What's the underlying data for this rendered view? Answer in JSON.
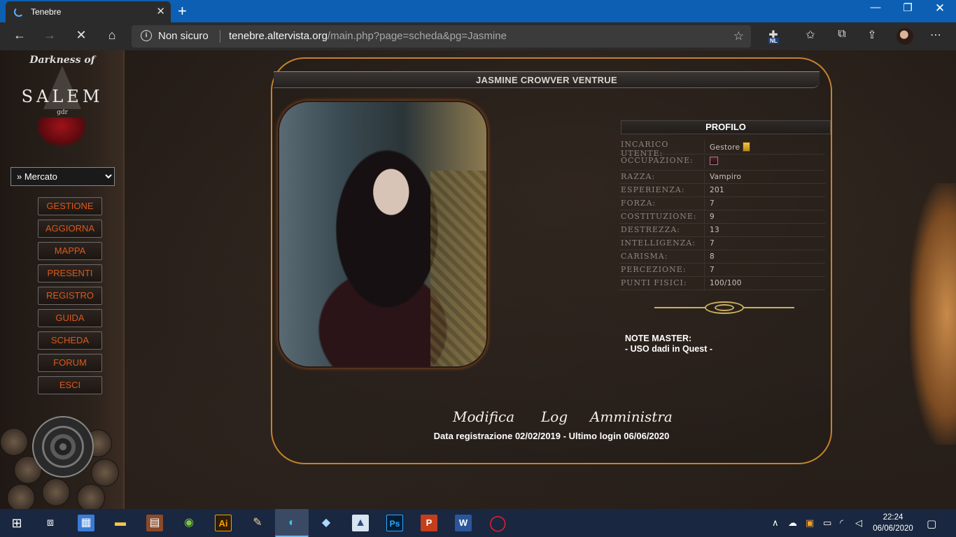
{
  "browser": {
    "tab_title": "Tenebre",
    "tab_close": "✕",
    "new_tab": "+",
    "window_min": "—",
    "window_max": "❐",
    "window_close": "✕",
    "security_label": "Non sicuro",
    "url_host": "tenebre.altervista.org",
    "url_path": "/main.php?page=scheda&pg=Jasmine",
    "ext_badge": "NL",
    "icons": [
      "back-arrow-icon",
      "forward-arrow-icon",
      "stop-icon",
      "home-icon",
      "info-icon",
      "favorite-star-icon",
      "extension-icon",
      "favorites-icon",
      "collections-icon",
      "share-icon",
      "profile-avatar",
      "more-icon"
    ]
  },
  "sidebar": {
    "logo": {
      "top": "Darkness of",
      "main": "SALEM",
      "sub": "gdr"
    },
    "select_value": "» Mercato",
    "nav": [
      {
        "label": "GESTIONE"
      },
      {
        "label": "AGGIORNA"
      },
      {
        "label": "MAPPA"
      },
      {
        "label": "PRESENTI"
      },
      {
        "label": "REGISTRO"
      },
      {
        "label": "GUIDA"
      },
      {
        "label": "SCHEDA"
      },
      {
        "label": "FORUM"
      },
      {
        "label": "ESCI"
      }
    ],
    "nav_color": "#d75a1c"
  },
  "profile": {
    "name": "JASMINE CROWVER VENTRUE",
    "section_title": "PROFILO",
    "stats": [
      {
        "key": "INCARICO UTENTE:",
        "value": "Gestore"
      },
      {
        "key": "OCCUPAZIONE:",
        "value": ""
      },
      {
        "key": "RAZZA:",
        "value": "Vampiro"
      },
      {
        "key": "ESPERIENZA:",
        "value": "201"
      },
      {
        "key": "FORZA:",
        "value": "7"
      },
      {
        "key": "COSTITUZIONE:",
        "value": "9"
      },
      {
        "key": "DESTREZZA:",
        "value": "13"
      },
      {
        "key": "INTELLIGENZA:",
        "value": "7"
      },
      {
        "key": "CARISMA:",
        "value": "8"
      },
      {
        "key": "PERCEZIONE:",
        "value": "7"
      },
      {
        "key": "PUNTI FISICI:",
        "value": "100/100"
      }
    ],
    "notes_title": "NOTE MASTER:",
    "notes_text": "- USO dadi in Quest -",
    "actions": {
      "modifica": "Modifica",
      "log": "Log",
      "amministra": "Amministra"
    },
    "registration_line": "Data registrazione 02/02/2019 - Ultimo login 06/06/2020",
    "border_color": "#c4822f"
  },
  "taskbar": {
    "time": "22:24",
    "date": "06/06/2020",
    "apps": [
      "windows-start-icon",
      "task-view-icon",
      "control-panel-icon",
      "file-explorer-icon",
      "movie-maker-icon",
      "utorrent-icon",
      "illustrator-icon",
      "paint-icon",
      "edge-icon",
      "fragment-icon",
      "writer-icon",
      "photoshop-icon",
      "powerpoint-icon",
      "word-icon",
      "opera-icon"
    ],
    "ai_label": "Ai",
    "ps_label": "Ps"
  }
}
